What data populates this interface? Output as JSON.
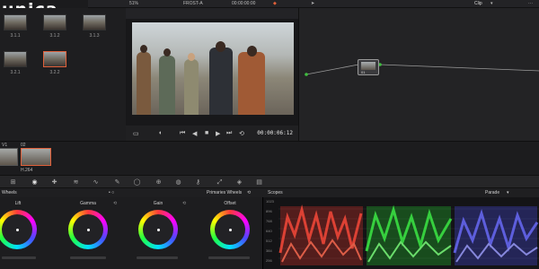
{
  "brand": {
    "part1": "unica",
    "accent": "#e13b34"
  },
  "topbar": {
    "zoom": "51%",
    "clip_name": "FROST-A",
    "timecode": "00:00:00:00",
    "right_label": "Clip"
  },
  "media_pool": {
    "thumbs": [
      {
        "label": "3.1.1"
      },
      {
        "label": "3.1.2"
      },
      {
        "label": "3.1.3"
      },
      {
        "label": "3.2.1"
      },
      {
        "label": "3.2.2"
      }
    ]
  },
  "viewer": {
    "timecode": "00:00:06:12"
  },
  "node": {
    "number": "01"
  },
  "timeline": {
    "clips": [
      {
        "top": "V1",
        "bottom": ""
      },
      {
        "top": "02",
        "bottom": "H.264"
      }
    ]
  },
  "panels": {
    "wheels_title": "Wheels",
    "primaries_title": "Primaries Wheels",
    "scopes_title": "Scopes",
    "scope_mode": "Parade"
  },
  "wheels": [
    {
      "name": "Lift"
    },
    {
      "name": "Gamma"
    },
    {
      "name": "Gain"
    },
    {
      "name": "Offset"
    }
  ],
  "scope_scale": [
    "1023",
    "896",
    "768",
    "640",
    "512",
    "384",
    "256"
  ],
  "colors": {
    "red": "#e8332a",
    "green": "#22d12e",
    "blue": "#4a4cf0",
    "selection": "#e0603a"
  }
}
